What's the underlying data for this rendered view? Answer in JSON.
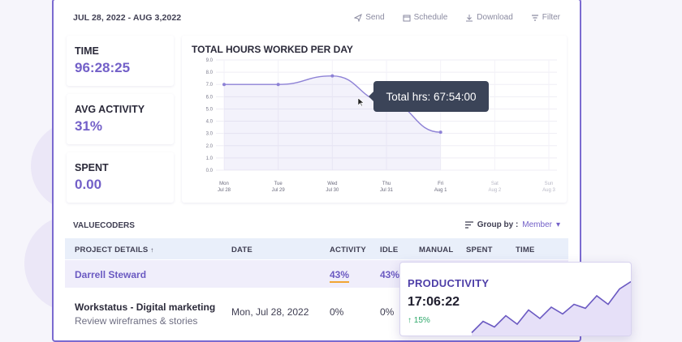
{
  "header": {
    "date_range": "JUL 28, 2022 - AUG 3,2022",
    "actions": [
      {
        "label": "Send",
        "icon": "send-icon"
      },
      {
        "label": "Schedule",
        "icon": "calendar-icon"
      },
      {
        "label": "Download",
        "icon": "download-icon"
      },
      {
        "label": "Filter",
        "icon": "filter-icon"
      }
    ]
  },
  "stats": [
    {
      "label": "TIME",
      "value": "96:28:25"
    },
    {
      "label": "AVG ACTIVITY",
      "value": "31%"
    },
    {
      "label": "SPENT",
      "value": "0.00"
    }
  ],
  "chart": {
    "title": "TOTAL HOURS WORKED PER DAY",
    "tooltip": "Total hrs: 67:54:00"
  },
  "chart_data": {
    "type": "line",
    "title": "TOTAL HOURS WORKED PER DAY",
    "ylim": [
      0,
      9
    ],
    "yticks": [
      "0.0",
      "1.0",
      "2.0",
      "3.0",
      "4.0",
      "5.0",
      "6.0",
      "7.0",
      "8.0",
      "9.0"
    ],
    "categories": [
      {
        "day": "Mon",
        "date": "Jul 28"
      },
      {
        "day": "Tue",
        "date": "Jul 29"
      },
      {
        "day": "Wed",
        "date": "Jul 30"
      },
      {
        "day": "Thu",
        "date": "Jul 31"
      },
      {
        "day": "Fri",
        "date": "Aug 1"
      },
      {
        "day": "Sat",
        "date": "Aug 2"
      },
      {
        "day": "Sun",
        "date": "Aug 3"
      }
    ],
    "series": [
      {
        "values": [
          7.0,
          7.0,
          7.7,
          5.6,
          3.1
        ]
      }
    ],
    "grid": true,
    "accent": "#8e82d6"
  },
  "table": {
    "company": "VALUECODERS",
    "group_by_label": "Group by :",
    "group_by_value": "Member",
    "columns": [
      "PROJECT DETAILS",
      "DATE",
      "ACTIVITY",
      "IDLE",
      "MANUAL",
      "SPENT",
      "TIME"
    ],
    "member_row": {
      "name": "Darrell Steward",
      "activity": "43%",
      "idle": "43%"
    },
    "project_row": {
      "project": "Workstatus - Digital marketing",
      "task": "Review wireframes & stories",
      "date": "Mon, Jul 28, 2022",
      "activity": "0%",
      "idle": "0%"
    }
  },
  "productivity": {
    "title": "PRODUCTIVITY",
    "time": "17:06:22",
    "change": "↑ 15%",
    "trend": [
      0.05,
      0.25,
      0.15,
      0.35,
      0.2,
      0.45,
      0.3,
      0.5,
      0.38,
      0.55,
      0.48,
      0.7,
      0.55,
      0.82,
      0.95
    ]
  },
  "colors": {
    "accent": "#7360c8",
    "border": "#7b6ad0",
    "positive": "#2fa86b"
  }
}
